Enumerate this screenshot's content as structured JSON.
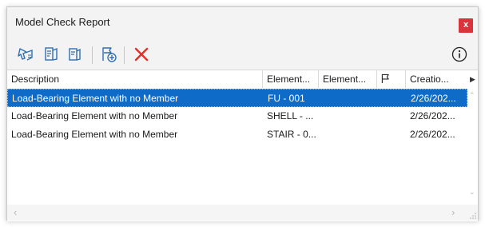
{
  "window": {
    "title": "Model Check Report",
    "close_label": "x"
  },
  "toolbar": {
    "buttons": [
      {
        "name": "select-elements-icon"
      },
      {
        "name": "element-settings-icon"
      },
      {
        "name": "member-settings-icon"
      },
      {
        "name": "add-flag-icon"
      },
      {
        "name": "delete-icon"
      },
      {
        "name": "info-icon"
      }
    ]
  },
  "table": {
    "columns": [
      "Description",
      "Element...",
      "Element...",
      "",
      "Creatio..."
    ],
    "rows": [
      {
        "description": "Load-Bearing Element with no Member",
        "element_id": "FU - 001",
        "element_type": "",
        "flag": "",
        "creation": "2/26/202...",
        "selected": true
      },
      {
        "description": "Load-Bearing Element with no Member",
        "element_id": "SHELL - ...",
        "element_type": "",
        "flag": "",
        "creation": "2/26/202...",
        "selected": false
      },
      {
        "description": "Load-Bearing Element with no Member",
        "element_id": "STAIR - 0...",
        "element_type": "",
        "flag": "",
        "creation": "2/26/202...",
        "selected": false
      }
    ]
  },
  "colors": {
    "selection": "#0e6cc8",
    "close": "#d9343b",
    "icon_blue": "#2f6fb3",
    "delete_red": "#e0302a"
  }
}
